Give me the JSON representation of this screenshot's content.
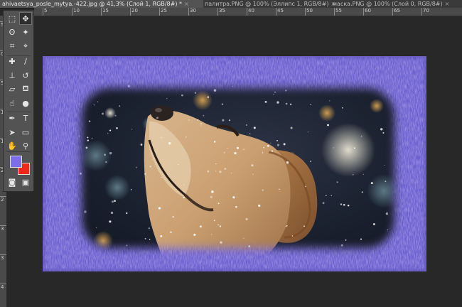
{
  "tabs": [
    {
      "label": "ahivaetsya_posle_mytya.-422.jpg @ 41,3% (Слой 1, RGB/8#) *",
      "close": "×",
      "active": true
    },
    {
      "label": "палитра.PNG @ 100% (Эллипс 1, RGB/8#)",
      "close": "×",
      "active": false
    },
    {
      "label": "маска.PNG @ 100% (Слой 0, RGB/8#)",
      "close": "×",
      "active": false
    }
  ],
  "ruler": {
    "top": [
      "5",
      "10",
      "15",
      "20",
      "25",
      "30",
      "35",
      "40",
      "45",
      "50",
      "55",
      "60",
      "65",
      "70"
    ],
    "left": [
      "5",
      "0",
      "5",
      "1",
      "1",
      "2",
      "2",
      "3",
      "3",
      "4"
    ]
  },
  "toolbar": {
    "tools": [
      {
        "name": "rectangular-marquee-icon",
        "glyph": "⬚"
      },
      {
        "name": "move-icon",
        "glyph": "✥",
        "selected": true
      },
      {
        "name": "lasso-icon",
        "glyph": "ʘ"
      },
      {
        "name": "magic-wand-icon",
        "glyph": "✦"
      },
      {
        "name": "crop-icon",
        "glyph": "⌗"
      },
      {
        "name": "eyedropper-icon",
        "glyph": "⌖"
      },
      {
        "name": "healing-brush-icon",
        "glyph": "✚"
      },
      {
        "name": "brush-icon",
        "glyph": "/"
      },
      {
        "name": "clone-stamp-icon",
        "glyph": "⊥"
      },
      {
        "name": "history-brush-icon",
        "glyph": "↺"
      },
      {
        "name": "eraser-icon",
        "glyph": "▱"
      },
      {
        "name": "paint-bucket-icon",
        "glyph": "⛾"
      },
      {
        "name": "smudge-icon",
        "glyph": "☝"
      },
      {
        "name": "dodge-icon",
        "glyph": "●"
      },
      {
        "name": "pen-icon",
        "glyph": "✒"
      },
      {
        "name": "type-icon",
        "glyph": "T"
      },
      {
        "name": "path-selection-icon",
        "glyph": "➤"
      },
      {
        "name": "rectangle-shape-icon",
        "glyph": "▭"
      },
      {
        "name": "hand-icon",
        "glyph": "✋"
      },
      {
        "name": "zoom-icon",
        "glyph": "⚲"
      },
      {
        "name": "quick-mask-icon",
        "glyph": "◙"
      },
      {
        "name": "screen-mode-icon",
        "glyph": "▣"
      }
    ],
    "foreground_color": "#7b6ee8",
    "background_color": "#f02818"
  }
}
